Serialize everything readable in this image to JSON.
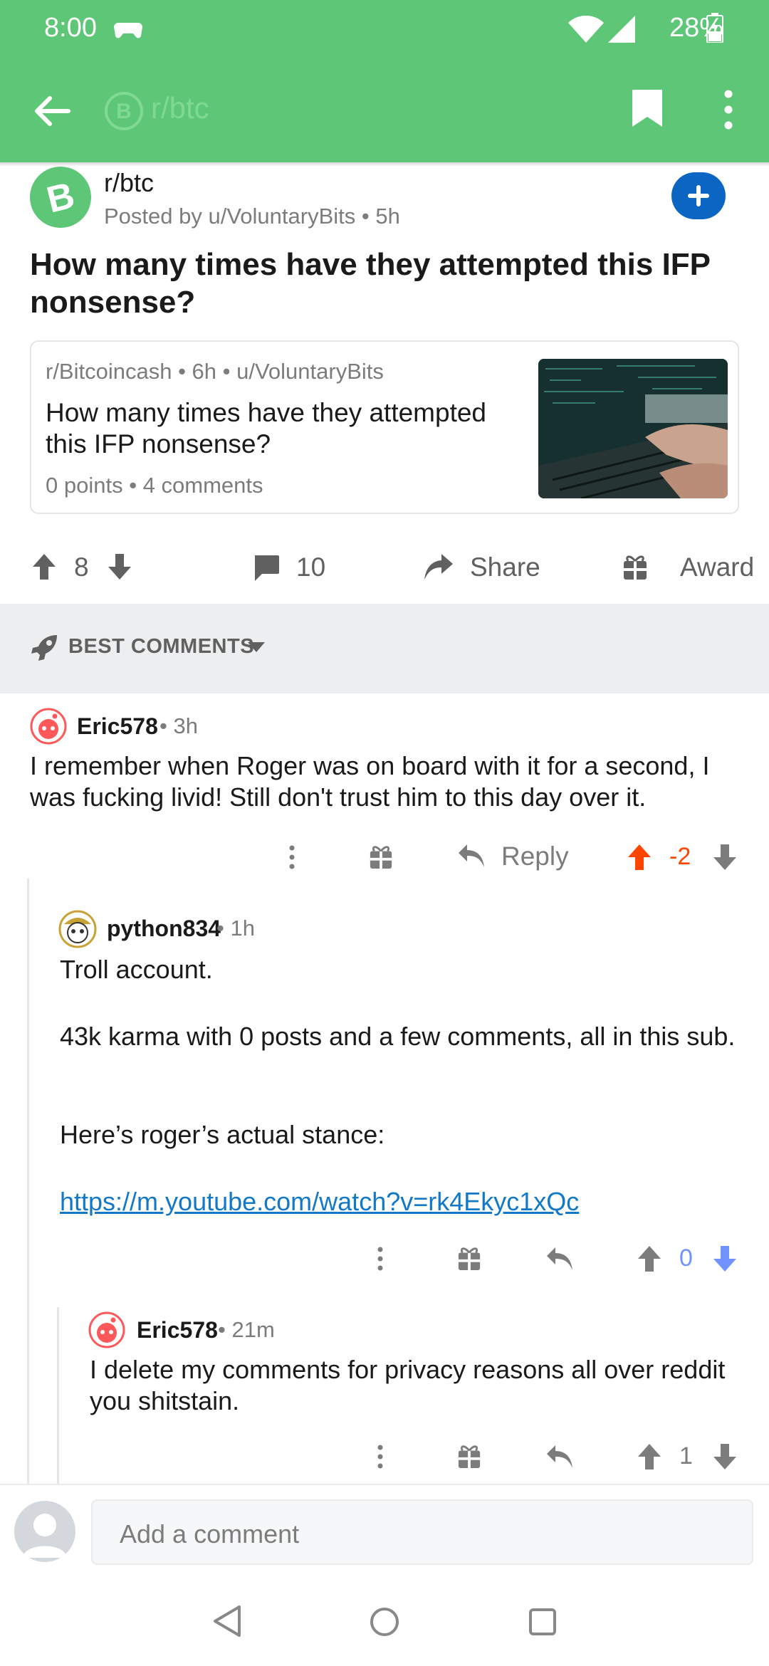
{
  "status_bar": {
    "time": "8:00",
    "battery": "28%"
  },
  "toolbar": {
    "title": "r/btc"
  },
  "post": {
    "subreddit": "r/btc",
    "posted_by": "Posted by u/VoluntaryBits",
    "age": "5h",
    "title": "How many times have they attempted this IFP nonsense?",
    "crosspost": {
      "meta": "r/Bitcoincash • 6h • u/VoluntaryBits",
      "title": "How many times have they attempted this IFP nonsense?",
      "stats": "0 points • 4 comments"
    },
    "actions": {
      "score": "8",
      "comments": "10",
      "share": "Share",
      "award": "Award"
    }
  },
  "sort": {
    "label": "BEST COMMENTS"
  },
  "comments": [
    {
      "author": "Eric578",
      "age": "3h",
      "body": "I remember when Roger was on board with it for a second, I was fucking livid! Still don't trust him to this day over it.",
      "reply_label": "Reply",
      "score": "-2"
    },
    {
      "author": "python834",
      "age": "1h",
      "body_p1": "Troll account.",
      "body_p2": "43k karma with 0 posts and a few comments, all in this sub.",
      "body_p3": "Here’s roger’s actual stance:",
      "link": "https://m.youtube.com/watch?v=rk4Ekyc1xQc",
      "score": "0"
    },
    {
      "author": "Eric578",
      "age": "21m",
      "body": "I delete my comments for privacy reasons all over reddit you shitstain.",
      "score": "1"
    }
  ],
  "comment_bar": {
    "placeholder": "Add a comment"
  },
  "colors": {
    "brand_green": "#5dc777",
    "upvote": "#ff4500",
    "downvote": "#7193ff",
    "link": "#1279c9"
  },
  "icons": [
    "back-arrow-icon",
    "bitcoin-cash-icon",
    "bookmark-icon",
    "overflow-menu-icon",
    "plus-icon",
    "upvote-icon",
    "downvote-icon",
    "comment-icon",
    "share-icon",
    "award-icon",
    "rocket-icon",
    "chevron-down-icon",
    "reply-icon",
    "nav-back-icon",
    "nav-home-icon",
    "nav-recents-icon"
  ]
}
